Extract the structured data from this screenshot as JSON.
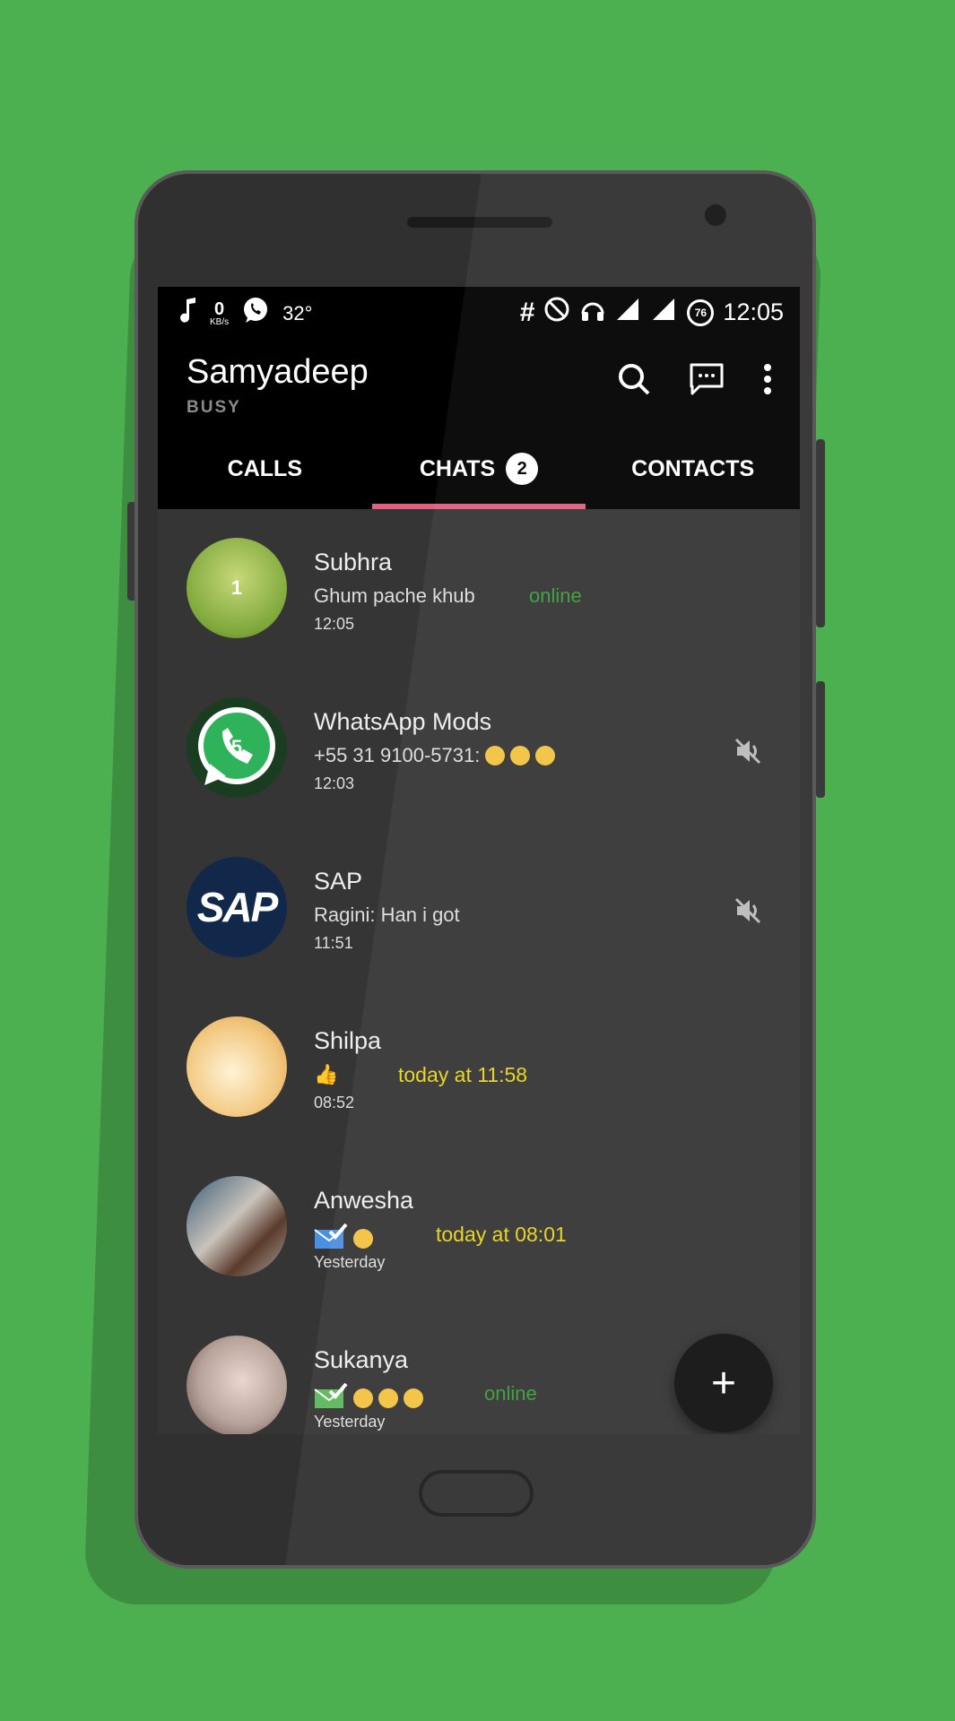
{
  "status_bar": {
    "kbs_value": "0",
    "kbs_unit": "KB/s",
    "temperature": "32°",
    "battery": "76",
    "clock": "12:05"
  },
  "app_bar": {
    "title": "Samyadeep",
    "subtitle": "BUSY"
  },
  "tabs": [
    {
      "label": "CALLS"
    },
    {
      "label": "CHATS",
      "count": "2",
      "active": true
    },
    {
      "label": "CONTACTS"
    }
  ],
  "chats": [
    {
      "name": "Subhra",
      "preview": "Ghum pache khub",
      "time": "12:05",
      "status": "online",
      "avatar_text": "1"
    },
    {
      "name": "WhatsApp Mods",
      "preview": "+55 31 9100-5731:",
      "time": "12:03",
      "avatar_text": "5",
      "muted": true
    },
    {
      "name": "SAP",
      "preview": "Ragini: Han i got",
      "time": "11:51",
      "avatar_text": "SAP",
      "muted": true
    },
    {
      "name": "Shilpa",
      "preview": "",
      "time": "08:52",
      "last_seen": "today at 11:58"
    },
    {
      "name": "Anwesha",
      "preview": "",
      "time": "Yesterday",
      "last_seen": "today at 08:01"
    },
    {
      "name": "Sukanya",
      "preview": "",
      "time": "Yesterday",
      "status": "online"
    }
  ],
  "fab": {
    "label": "+"
  },
  "colors": {
    "background": "#4caf50",
    "tab_indicator": "#e0607e",
    "online": "#3a9c3a",
    "last_seen": "#e6d31e"
  }
}
